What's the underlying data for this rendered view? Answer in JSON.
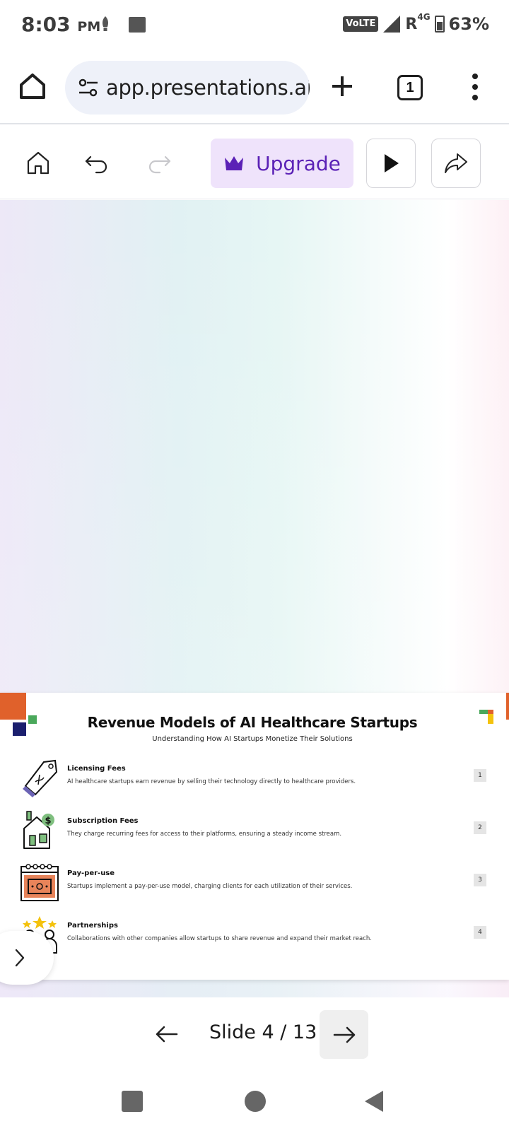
{
  "status_bar": {
    "time": "8:03",
    "ampm": "PM",
    "volte": "VoLTE",
    "roaming": "R",
    "network": "4G",
    "battery": "63%"
  },
  "browser": {
    "url": "app.presentations.ai",
    "tab_count": "1"
  },
  "toolbar": {
    "upgrade_label": "Upgrade"
  },
  "slide": {
    "title": "Revenue Models of AI Healthcare Startups",
    "subtitle": "Understanding How AI Startups Monetize Their Solutions",
    "items": [
      {
        "title": "Licensing Fees",
        "desc": "AI healthcare startups earn revenue by selling their technology directly to healthcare providers.",
        "num": "1",
        "icon": "price-tag-icon"
      },
      {
        "title": "Subscription Fees",
        "desc": "They charge recurring fees for access to their platforms, ensuring a steady income stream.",
        "num": "2",
        "icon": "house-dollar-icon"
      },
      {
        "title": "Pay-per-use",
        "desc": "Startups implement a pay-per-use model, charging clients for each utilization of their services.",
        "num": "3",
        "icon": "calendar-cash-icon"
      },
      {
        "title": "Partnerships",
        "desc": "Collaborations with other companies allow startups to share revenue and expand their market reach.",
        "num": "4",
        "icon": "partners-stars-icon"
      }
    ]
  },
  "pager": {
    "label": "Slide 4 / 13"
  },
  "colors": {
    "accent_purple": "#5b21b6",
    "upgrade_bg": "#efe3fb",
    "deco_orange": "#e0612b",
    "deco_green": "#4aa85b",
    "deco_navy": "#1b1f6e"
  }
}
